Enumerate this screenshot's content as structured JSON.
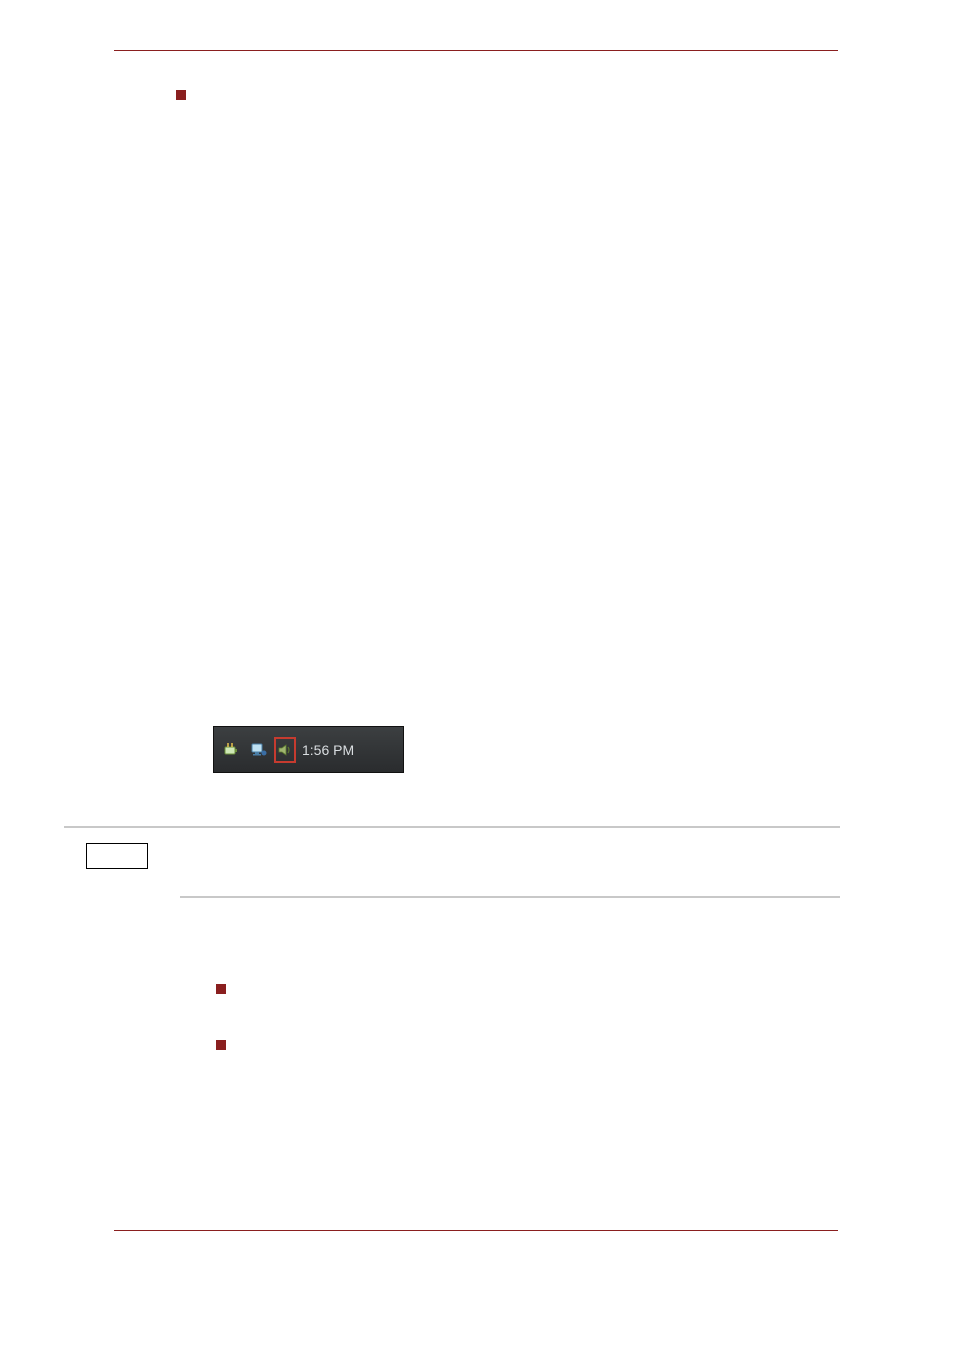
{
  "tray": {
    "time": "1:56 PM"
  },
  "icons": {
    "battery": "battery-icon",
    "network": "network-icon",
    "speaker": "speaker-icon"
  }
}
